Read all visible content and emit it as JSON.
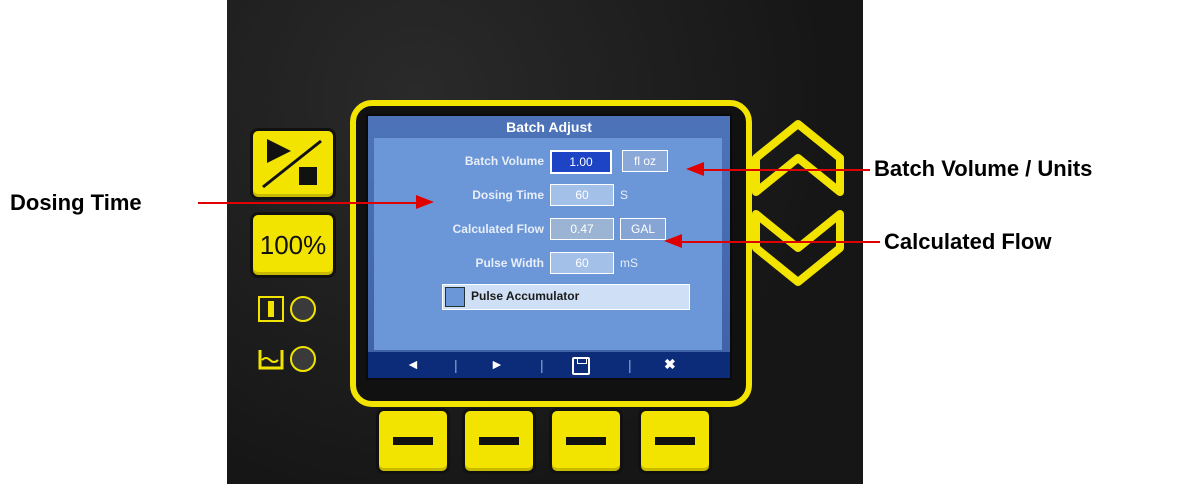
{
  "screen": {
    "title": "Batch Adjust",
    "fields": {
      "batch_volume": {
        "label": "Batch Volume",
        "value": "1.00",
        "unit": "fl oz"
      },
      "dosing_time": {
        "label": "Dosing Time",
        "value": "60",
        "unit": "S"
      },
      "calculated_flow": {
        "label": "Calculated Flow",
        "value": "0.47",
        "unit": "GAL"
      },
      "pulse_width": {
        "label": "Pulse Width",
        "value": "60",
        "unit": "mS"
      }
    },
    "checkbox": {
      "label": "Pulse Accumulator",
      "checked": false
    },
    "statusbar": {
      "prev": "◄",
      "next": "►",
      "save": "🖫",
      "close": "✖",
      "separator": "|"
    }
  },
  "panel": {
    "percent_button": "100%"
  },
  "annotations": {
    "dosing_time": "Dosing Time",
    "batch_volume_units": "Batch Volume / Units",
    "calculated_flow": "Calculated Flow"
  },
  "colors": {
    "accent_yellow": "#f3e400",
    "screen_blue": "#6b97d8",
    "arrow_red": "#e00000"
  }
}
